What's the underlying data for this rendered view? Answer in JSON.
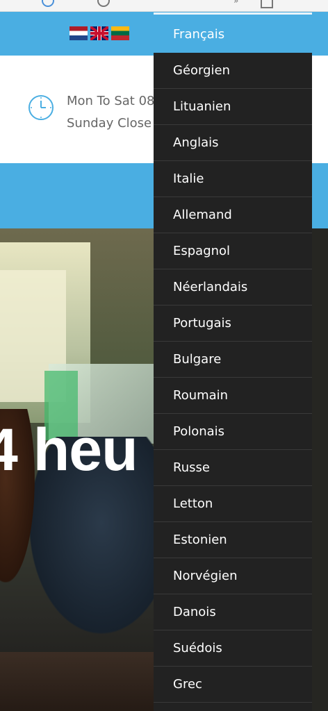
{
  "header": {
    "hours_line1": "Mon To Sat 08",
    "hours_line2": "Sunday Close"
  },
  "hero": {
    "headline": "4 heu"
  },
  "language_menu": {
    "selected": "Français",
    "items": [
      "Géorgien",
      "Lituanien",
      "Anglais",
      "Italie",
      "Allemand",
      "Espagnol",
      "Néerlandais",
      "Portugais",
      "Bulgare",
      "Roumain",
      "Polonais",
      "Russe",
      "Letton",
      "Estonien",
      "Norvégien",
      "Danois",
      "Suédois",
      "Grec"
    ]
  },
  "colors": {
    "brand_blue": "#4aaee2",
    "menu_bg": "#222222"
  },
  "icons": [
    "flag-netherlands-icon",
    "flag-uk-icon",
    "flag-lithuania-icon",
    "clock-icon"
  ]
}
